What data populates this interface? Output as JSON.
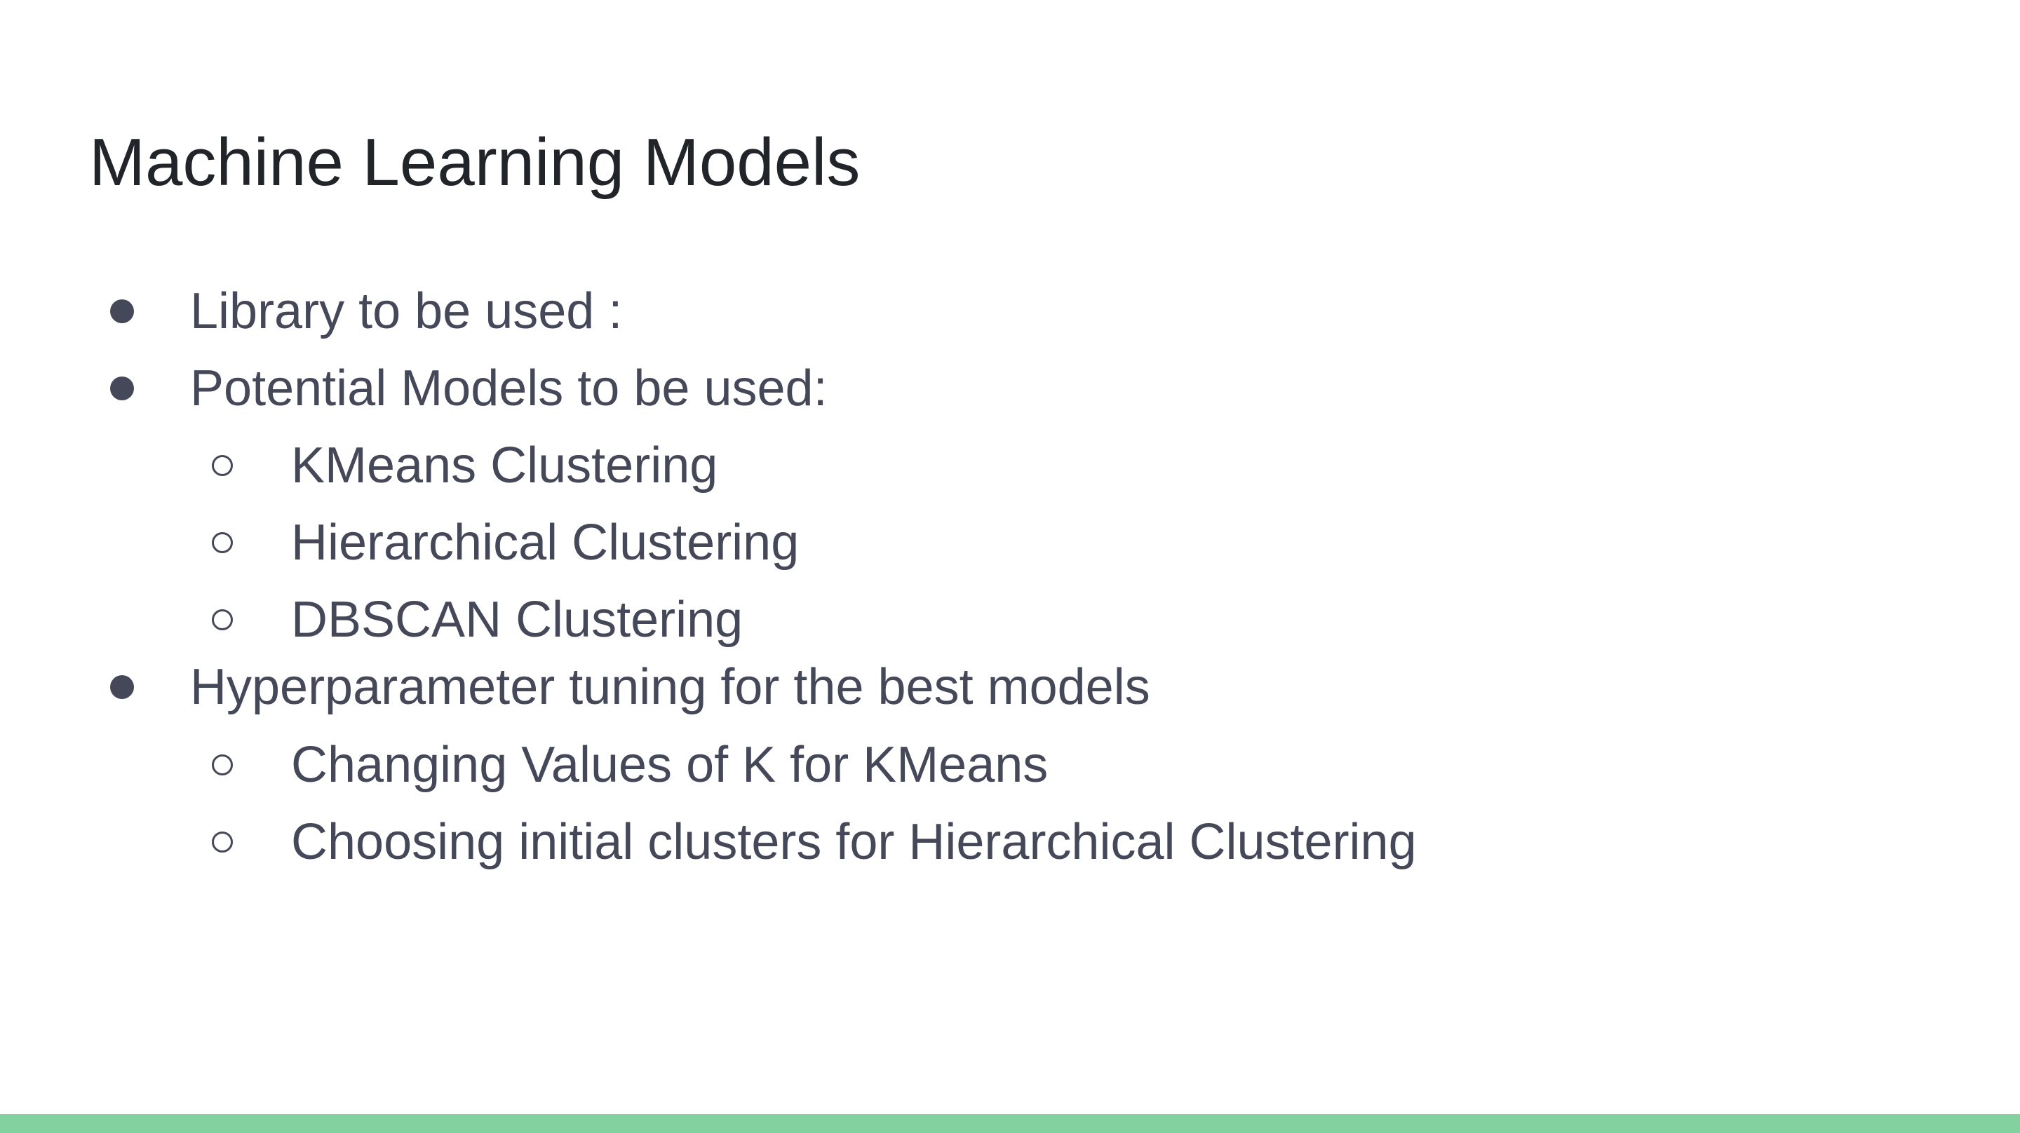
{
  "slide": {
    "title": "Machine Learning Models",
    "bullets": [
      {
        "level": 1,
        "marker": "filled-circle",
        "text": "Library to be used :"
      },
      {
        "level": 1,
        "marker": "filled-circle",
        "text": "Potential Models to be used:"
      },
      {
        "level": 2,
        "marker": "hollow-circle",
        "text": "KMeans Clustering"
      },
      {
        "level": 2,
        "marker": "hollow-circle",
        "text": "Hierarchical Clustering"
      },
      {
        "level": 2,
        "marker": "hollow-circle",
        "text": "DBSCAN Clustering"
      },
      {
        "level": 1,
        "marker": "filled-circle",
        "text": "Hyperparameter tuning for the best models"
      },
      {
        "level": 2,
        "marker": "hollow-circle",
        "text": "Changing Values of K for KMeans"
      },
      {
        "level": 2,
        "marker": "hollow-circle",
        "text": "Choosing initial clusters for Hierarchical Clustering"
      }
    ]
  },
  "colors": {
    "background": "#ffffff",
    "title_text": "#212529",
    "body_text": "#454858",
    "footer_accent": "#84d1a0"
  }
}
